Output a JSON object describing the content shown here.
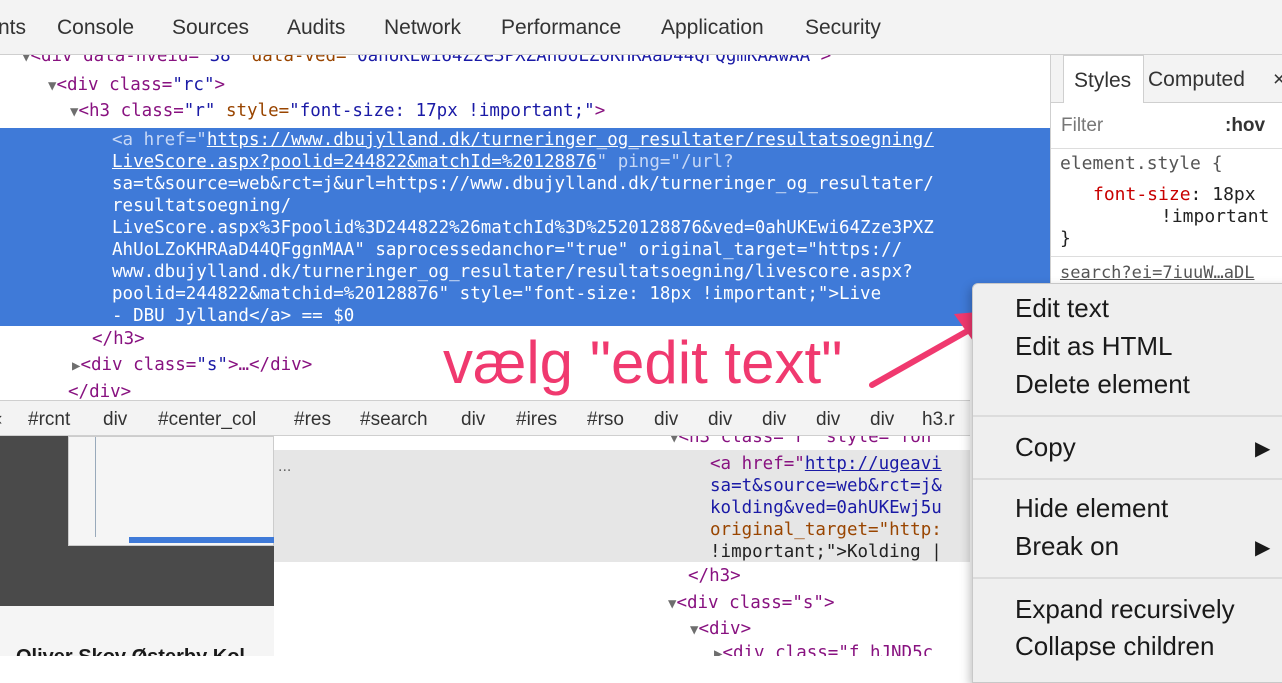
{
  "tabs": [
    "nts",
    "Console",
    "Sources",
    "Audits",
    "Network",
    "Performance",
    "Application",
    "Security"
  ],
  "tree": {
    "line0": {
      "attrs1": "div data-hveid=",
      "v1": "\"38\"",
      "a2": " data-ved=",
      "v2": "\"0ahUKEwi64Zze3PXZAhUoLZoKHRAaD44QFQgmKAAwAA\"",
      "close": ">"
    },
    "line1": {
      "open": "<div class=",
      "v": "\"rc\"",
      "close": ">"
    },
    "line2": {
      "open": "<h3 class=",
      "v": "\"r\"",
      "a2": " style=",
      "v2": "\"font-size: 17px !important;\"",
      "close": ">"
    },
    "selected": [
      {
        "pre": "<a href=\"",
        "link": "https://www.dbujylland.dk/turneringer_og_resultater/resultatsoegning/",
        "post": ""
      },
      {
        "pre": "",
        "link": "LiveScore.aspx?poolid=244822&matchId=%20128876",
        "post": "\" ping=\"/url?"
      },
      {
        "pre": "sa=t&source=web&rct=j&url=https://www.dbujylland.dk/turneringer_og_resultater/",
        "link": "",
        "post": ""
      },
      {
        "pre": "resultatsoegning/",
        "link": "",
        "post": ""
      },
      {
        "pre": "LiveScore.aspx%3Fpoolid%3D244822%26matchId%3D%2520128876&ved=0ahUKEwi64Zze3PXZ",
        "link": "",
        "post": ""
      },
      {
        "pre": "AhUoLZoKHRAaD44QFggnMAA\" saprocessedanchor=\"true\" original_target=\"https://",
        "link": "",
        "post": ""
      },
      {
        "pre": "www.dbujylland.dk/turneringer_og_resultater/resultatsoegning/livescore.aspx?",
        "link": "",
        "post": ""
      },
      {
        "pre": "poolid=244822&matchid=%20128876\" style=\"font-size: 18px !important;\">Live",
        "link": "",
        "post": ""
      },
      {
        "pre": "- DBU Jylland</a> == $0",
        "link": "",
        "post": ""
      }
    ],
    "close_h3": "</h3>",
    "div_s": {
      "open": "<div class=",
      "v": "\"s\"",
      "close": ">…</div>"
    },
    "close_div": "</div>"
  },
  "styles": {
    "tab_styles": "Styles",
    "tab_computed": "Computed",
    "close": "×",
    "filter_placeholder": "Filter",
    "hov": ":hov",
    "selector": "element.style {",
    "prop": "font-size",
    "value": "18px",
    "important": "!important",
    "closebrace": "}",
    "source": "search?ei=7iuuW…aDL"
  },
  "breadcrumbs": [
    "#rcnt",
    "div",
    "#center_col",
    "#res",
    "#search",
    "div",
    "#ires",
    "#rso",
    "div",
    "div",
    "div",
    "div",
    "div",
    "h3.r"
  ],
  "bg": {
    "line_h3": "<h3 class=\"r\" style=\"fon",
    "line_a": "<a href=\"",
    "link": "http://ugeavi",
    "l1": "sa=t&source=web&rct=j&",
    "l2": "kolding&ved=0ahUKEwj5u",
    "l3": "original_target=\"http:",
    "l4": "!important;\">Kolding |",
    "close_h3": "</h3>",
    "div_s": "<div class=\"s\">",
    "div": "<div>",
    "div_last": "<div class=\"f hJND5c",
    "dots": "...",
    "bottom_text": "Oliver Skov Østerby Kol"
  },
  "menu": {
    "edit_text": "Edit text",
    "edit_html": "Edit as HTML",
    "delete": "Delete element",
    "copy": "Copy",
    "hide": "Hide element",
    "break_on": "Break on",
    "expand": "Expand recursively",
    "collapse": "Collapse children",
    "arrow": "▶"
  },
  "annotation": "vælg \"edit text\"",
  "colors": {
    "selection": "#3f7ad8",
    "annotation": "#f0396f",
    "tag": "#881280",
    "attr": "#994500",
    "value": "#1a1aa6"
  }
}
